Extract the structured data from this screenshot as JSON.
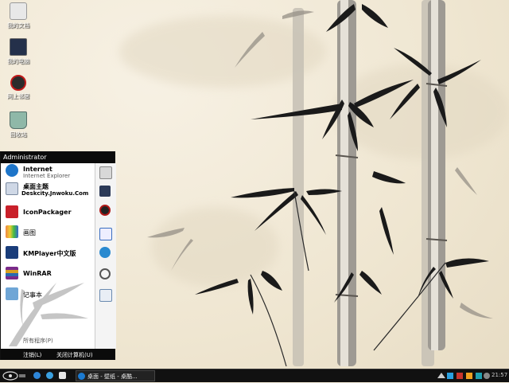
{
  "desktop": {
    "icons": [
      {
        "label": "我的文档",
        "icon": "my-documents-icon"
      },
      {
        "label": "我的电脑",
        "icon": "my-computer-icon"
      },
      {
        "label": "网上邻居",
        "icon": "network-places-icon"
      },
      {
        "label": "回收站",
        "icon": "recycle-bin-icon"
      }
    ]
  },
  "start_menu": {
    "user": "Administrator",
    "programs": [
      {
        "title": "Internet",
        "subtitle": "Internet Explorer",
        "icon": "internet-explorer-icon"
      },
      {
        "title": "桌面主题",
        "subtitle": "",
        "icon": "desktop-theme-icon"
      },
      {
        "title": "IconPackager",
        "subtitle": "",
        "icon": "iconpackager-icon"
      },
      {
        "title": "画图",
        "subtitle": "",
        "icon": "paint-icon"
      },
      {
        "title": "KMPlayer中文版",
        "subtitle": "",
        "icon": "kmplayer-icon"
      },
      {
        "title": "WinRAR",
        "subtitle": "",
        "icon": "winrar-icon"
      },
      {
        "title": "记事本",
        "subtitle": "",
        "icon": "notepad-icon"
      }
    ],
    "overlay_text": "Deskcity.Jnwoku.Com",
    "right_icons": [
      "my-documents-icon",
      "my-documents-icon",
      "users-icon",
      "control-panel-icon",
      "network-icon",
      "search-icon",
      "run-icon"
    ],
    "all_programs": "所有程序(P)",
    "logoff": "注销(L)",
    "shutdown": "关闭计算机(U)"
  },
  "taskbar": {
    "task_label": "桌面 - 壁纸 - 桌酷...",
    "clock": "21:57",
    "start_icon": "start-orb-icon"
  },
  "colors": {
    "taskbar": "#111111",
    "menu_header": "#0b0b0b",
    "desktop_bg": "#f1e9d6"
  }
}
